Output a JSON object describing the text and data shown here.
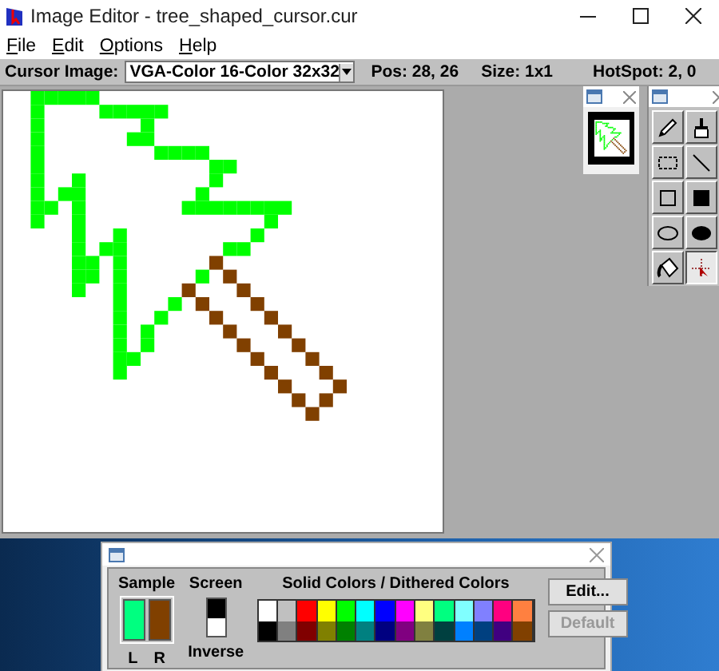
{
  "window": {
    "title": "Image Editor - tree_shaped_cursor.cur"
  },
  "menu": [
    {
      "label": "File"
    },
    {
      "label": "Edit"
    },
    {
      "label": "Options"
    },
    {
      "label": "Help"
    }
  ],
  "toolbar": {
    "image_label": "Cursor Image:",
    "image_select": "VGA-Color 16-Color 32x32",
    "pos": "Pos: 28, 26",
    "size": "Size: 1x1",
    "hotspot": "HotSpot: 2, 0"
  },
  "tools": [
    {
      "kind": "pencil",
      "selected": false
    },
    {
      "kind": "brush",
      "selected": false
    },
    {
      "kind": "select",
      "selected": false
    },
    {
      "kind": "line",
      "selected": false
    },
    {
      "kind": "rect",
      "selected": false
    },
    {
      "kind": "fillrect",
      "selected": false
    },
    {
      "kind": "ellipse",
      "selected": false
    },
    {
      "kind": "fillellipse",
      "selected": false
    },
    {
      "kind": "fill",
      "selected": false
    },
    {
      "kind": "hotspot",
      "selected": true
    }
  ],
  "palette": {
    "sample_label": "Sample",
    "sample": [
      {
        "label": "L",
        "color": "#00ff80"
      },
      {
        "label": "R",
        "color": "#804000"
      }
    ],
    "screen_label": "Screen",
    "inverse_label": "Inverse",
    "heading": "Solid Colors / Dithered Colors",
    "colors": [
      {
        "color": "#ffffff"
      },
      {
        "color": "#c0c0c0"
      },
      {
        "color": "#ff0000"
      },
      {
        "color": "#ffff00"
      },
      {
        "color": "#00ff00"
      },
      {
        "color": "#00ffff"
      },
      {
        "color": "#0000ff"
      },
      {
        "color": "#ff00ff"
      },
      {
        "color": "#ffff80"
      },
      {
        "color": "#00ff80"
      },
      {
        "color": "#80ffff"
      },
      {
        "color": "#8080ff"
      },
      {
        "color": "#ff0080"
      },
      {
        "color": "#ff8040"
      },
      {
        "color": "#000000"
      },
      {
        "color": "#808080"
      },
      {
        "color": "#800000"
      },
      {
        "color": "#808000"
      },
      {
        "color": "#008000"
      },
      {
        "color": "#008080"
      },
      {
        "color": "#000080"
      },
      {
        "color": "#800080"
      },
      {
        "color": "#808040"
      },
      {
        "color": "#004040"
      },
      {
        "color": "#0080ff"
      },
      {
        "color": "#004080"
      },
      {
        "color": "#400080"
      },
      {
        "color": "#804000"
      }
    ],
    "buttons": [
      {
        "label": "Edit...",
        "disabled": false
      },
      {
        "label": "Default",
        "disabled": true
      }
    ]
  }
}
